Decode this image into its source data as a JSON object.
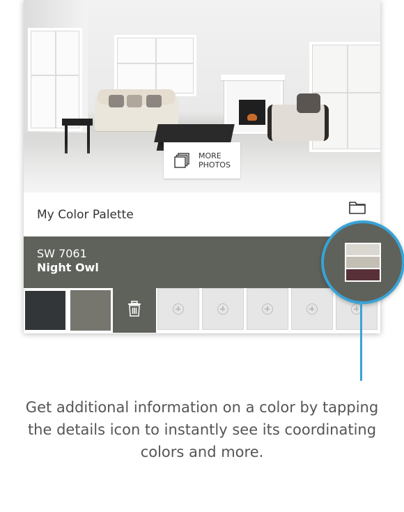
{
  "more_photos": {
    "label": "MORE\nPHOTOS"
  },
  "palette": {
    "title": "My Color Palette"
  },
  "selected_color": {
    "code": "SW 7061",
    "name": "Night Owl",
    "hex": "#5f625b"
  },
  "swatches": [
    {
      "color": "#323639"
    },
    {
      "color": "#76766f"
    }
  ],
  "details_bands": [
    "#dad7d0",
    "#c4bfb5",
    "#583038"
  ],
  "empty_slots": 5,
  "colors": {
    "accent": "#39a3d6",
    "trash_bg": "#5f625b",
    "band": "#5f625b"
  },
  "caption": "Get additional information on a color by tapping the details icon to instantly see its coordinating colors and more."
}
